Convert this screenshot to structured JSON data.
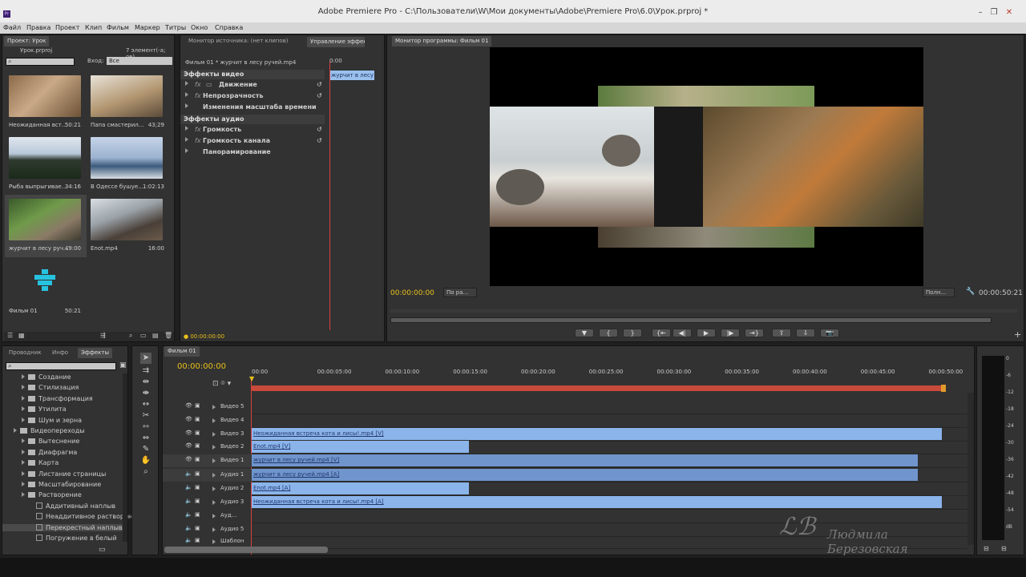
{
  "window": {
    "title": "Adobe Premiere Pro - C:\\Пользователи\\W\\Мои документы\\Adobe\\Premiere Pro\\6.0\\Урок.prproj *",
    "app_icon": "Pr"
  },
  "menu": [
    "Файл",
    "Правка",
    "Проект",
    "Клип",
    "Фильм",
    "Маркер",
    "Титры",
    "Окно",
    "Справка"
  ],
  "project": {
    "tab": "Проект: Урок",
    "file": "Урок.prproj",
    "count": "7 элемент(-а; ов)",
    "input_label": "Вход:",
    "input_value": "Все",
    "items": [
      {
        "name": "Неожиданная вст...",
        "dur": "50:21",
        "kind": "video"
      },
      {
        "name": "Папа смастерил...",
        "dur": "43;29",
        "kind": "video"
      },
      {
        "name": "Рыба выпрыгивае...",
        "dur": "34:16",
        "kind": "video"
      },
      {
        "name": "В Одессе бушуе...",
        "dur": "1:02:13",
        "kind": "video"
      },
      {
        "name": "журчит в лесу руч...",
        "dur": "49:00",
        "kind": "video"
      },
      {
        "name": "Enot.mp4",
        "dur": "16:00",
        "kind": "video"
      },
      {
        "name": "Фильм 01",
        "dur": "50:21",
        "kind": "sequence"
      }
    ]
  },
  "source_monitor": {
    "tab": "Монитор источника: (нет клипов)"
  },
  "effect_controls": {
    "tab": "Управление эффект",
    "clip_path": "Фильм 01 * журчит в лесу ручей.mp4",
    "clip_name": "журчит в лесу р",
    "video_header": "Эффекты видео",
    "video_effects": [
      "Движение",
      "Непрозрачность",
      "Изменения масштаба времени"
    ],
    "audio_header": "Эффекты аудио",
    "audio_effects": [
      "Громкость",
      "Громкость канала",
      "Панорамирование"
    ],
    "timecode": "00:00:00:00"
  },
  "program_monitor": {
    "tab": "Монитор программы: Фильм 01",
    "timecode": "00:00:00:00",
    "fit": "По ра...",
    "quality": "Полн...",
    "duration": "00:00:50:21"
  },
  "effects_panel": {
    "tabs": [
      "Проводник",
      "Инфо",
      "Эффекты"
    ],
    "tree": [
      {
        "label": "Создание",
        "level": 1,
        "type": "folder"
      },
      {
        "label": "Стилизация",
        "level": 1,
        "type": "folder"
      },
      {
        "label": "Трансформация",
        "level": 1,
        "type": "folder"
      },
      {
        "label": "Утилита",
        "level": 1,
        "type": "folder"
      },
      {
        "label": "Шум и зерна",
        "level": 1,
        "type": "folder"
      },
      {
        "label": "Видеопереходы",
        "level": 0,
        "type": "folder"
      },
      {
        "label": "Вытеснение",
        "level": 1,
        "type": "folder"
      },
      {
        "label": "Диафрагма",
        "level": 1,
        "type": "folder"
      },
      {
        "label": "Карта",
        "level": 1,
        "type": "folder"
      },
      {
        "label": "Листание страницы",
        "level": 1,
        "type": "folder"
      },
      {
        "label": "Масштабирование",
        "level": 1,
        "type": "folder"
      },
      {
        "label": "Растворение",
        "level": 1,
        "type": "folder"
      },
      {
        "label": "Аддитивный наплыв",
        "level": 2,
        "type": "fx"
      },
      {
        "label": "Неаддитивное растворение",
        "level": 2,
        "type": "fx"
      },
      {
        "label": "Перекрестный наплыв",
        "level": 2,
        "type": "fx"
      },
      {
        "label": "Погружение в белый",
        "level": 2,
        "type": "fx"
      }
    ]
  },
  "timeline": {
    "tab": "Фильм 01",
    "timecode": "00:00:00:00",
    "ruler": [
      "00:00",
      "00:00:05:00",
      "00:00:10:00",
      "00:00:15:00",
      "00:00:20:00",
      "00:00:25:00",
      "00:00:30:00",
      "00:00:35:00",
      "00:00:40:00",
      "00:00:45:00",
      "00:00:50:00"
    ],
    "tracks": [
      "Видео 5",
      "Видео 4",
      "Видео 3",
      "Видео 2",
      "Видео 1",
      "Аудио 1",
      "Аудио 2",
      "Аудио 3",
      "Ауд...",
      "Аудио 5",
      "Шаблон"
    ],
    "clips": [
      {
        "track": 2,
        "label": "Неожиданная встреча кота и лисы!.mp4 [V]",
        "start": 0,
        "end": 50.8
      },
      {
        "track": 3,
        "label": "Enot.mp4 [V]",
        "start": 0,
        "end": 16
      },
      {
        "track": 4,
        "label": "журчит в лесу ручей.mp4 [V]",
        "start": 0,
        "end": 49
      },
      {
        "track": 5,
        "label": "журчит в лесу ручей.mp4 [A]",
        "start": 0,
        "end": 49
      },
      {
        "track": 6,
        "label": "Enot.mp4 [A]",
        "start": 0,
        "end": 16
      },
      {
        "track": 7,
        "label": "Неожиданная встреча кота и лисы!.mp4 [A]",
        "start": 0,
        "end": 50.8
      }
    ]
  },
  "audio_meter": {
    "scale": [
      "0",
      "-6",
      "-12",
      "-18",
      "-24",
      "-30",
      "-36",
      "-42",
      "-48",
      "-54",
      "dB"
    ]
  },
  "watermark": "Людмила Березовская",
  "colors": {
    "accent_timecode": "#e8c01a",
    "clip_blue": "#8ab4ea",
    "clip_blue_dark": "#6f95cc"
  }
}
